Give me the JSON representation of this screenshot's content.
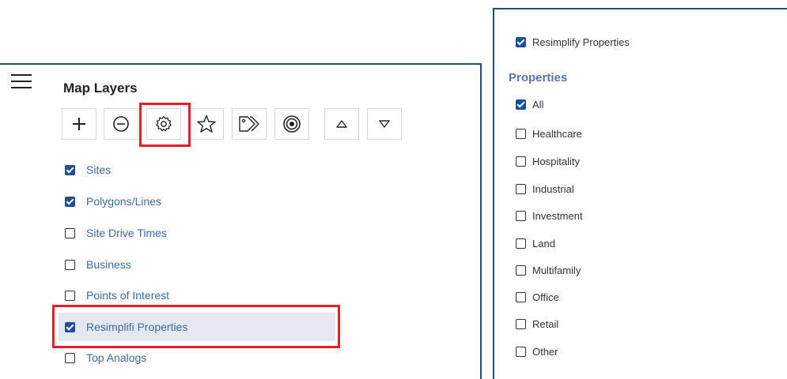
{
  "map_layers": {
    "title": "Map Layers",
    "toolbar": {
      "add_icon": "plus-icon",
      "remove_icon": "minus-circle-icon",
      "settings_icon": "gear-icon",
      "favorite_icon": "star-icon",
      "tags_icon": "tags-icon",
      "target_icon": "target-icon",
      "move_up_icon": "triangle-up-icon",
      "move_down_icon": "triangle-down-icon"
    },
    "layers": [
      {
        "label": "Sites",
        "checked": true
      },
      {
        "label": "Polygons/Lines",
        "checked": true
      },
      {
        "label": "Site Drive Times",
        "checked": false
      },
      {
        "label": "Business",
        "checked": false
      },
      {
        "label": "Points of Interest",
        "checked": false
      },
      {
        "label": "Resimplifi Properties",
        "checked": true
      },
      {
        "label": "Top Analogs",
        "checked": false
      }
    ]
  },
  "properties_panel": {
    "toggle_label": "Resimplify Properties",
    "heading": "Properties",
    "options": [
      {
        "label": "All",
        "checked": true
      },
      {
        "label": "Healthcare",
        "checked": false
      },
      {
        "label": "Hospitality",
        "checked": false
      },
      {
        "label": "Industrial",
        "checked": false
      },
      {
        "label": "Investment",
        "checked": false
      },
      {
        "label": "Land",
        "checked": false
      },
      {
        "label": "Multifamily",
        "checked": false
      },
      {
        "label": "Office",
        "checked": false
      },
      {
        "label": "Retail",
        "checked": false
      },
      {
        "label": "Other",
        "checked": false
      }
    ]
  },
  "colors": {
    "accent": "#1f4e9b",
    "panel_border": "#1f4e79",
    "highlight": "#e0202a",
    "layer_label": "#3f6aa0",
    "heading": "#5a73a8"
  }
}
